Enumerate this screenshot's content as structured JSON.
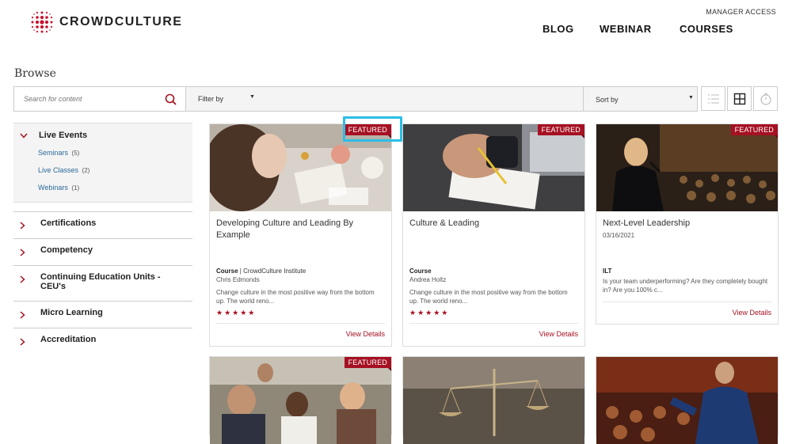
{
  "header": {
    "logo": {
      "part1": "CROWD",
      "part2": "CULTURE"
    },
    "manager_access": "MANAGER ACCESS",
    "nav": [
      "BLOG",
      "WEBINAR",
      "COURSES"
    ]
  },
  "browse_title": "Browse",
  "search": {
    "placeholder": "Search for content"
  },
  "filter": {
    "label": "Filter by"
  },
  "sort": {
    "label": "Sort by"
  },
  "sidebar": {
    "live_events": {
      "label": "Live Events",
      "items": [
        {
          "label": "Seminars",
          "count": "(5)"
        },
        {
          "label": "Live Classes",
          "count": "(2)"
        },
        {
          "label": "Webinars",
          "count": "(1)"
        }
      ]
    },
    "categories": [
      "Certifications",
      "Competency",
      "Continuing Education Units - CEU's",
      "Micro Learning",
      "Accreditation"
    ]
  },
  "cards": [
    {
      "badge": "FEATURED",
      "title": "Developing Culture and Leading By Example",
      "date": "",
      "type": "Course",
      "org": "CrowdCulture Institute",
      "author": "Chris Edmonds",
      "desc": "Change culture in the most positive way from the bottom up. The world reno...",
      "stars": "★★★★★",
      "link": "View Details"
    },
    {
      "badge": "FEATURED",
      "title": "Culture & Leading",
      "date": "",
      "type": "Course",
      "org": "",
      "author": "Andrea Holtz",
      "desc": "Change culture in the most positive way from the bottom up. The world reno...",
      "stars": "★★★★★",
      "link": "View Details"
    },
    {
      "badge": "FEATURED",
      "title": "Next-Level Leadership",
      "date": "03/16/2021",
      "type": "ILT",
      "org": "",
      "author": "",
      "desc": "Is your team underperforming? Are they completely bought in? Are you 100% c...",
      "stars": "",
      "link": "View Details"
    },
    {
      "badge": "FEATURED"
    }
  ],
  "colors": {
    "accent": "#a51022",
    "link": "#2a6a9a",
    "highlight": "#2bbfe6"
  }
}
